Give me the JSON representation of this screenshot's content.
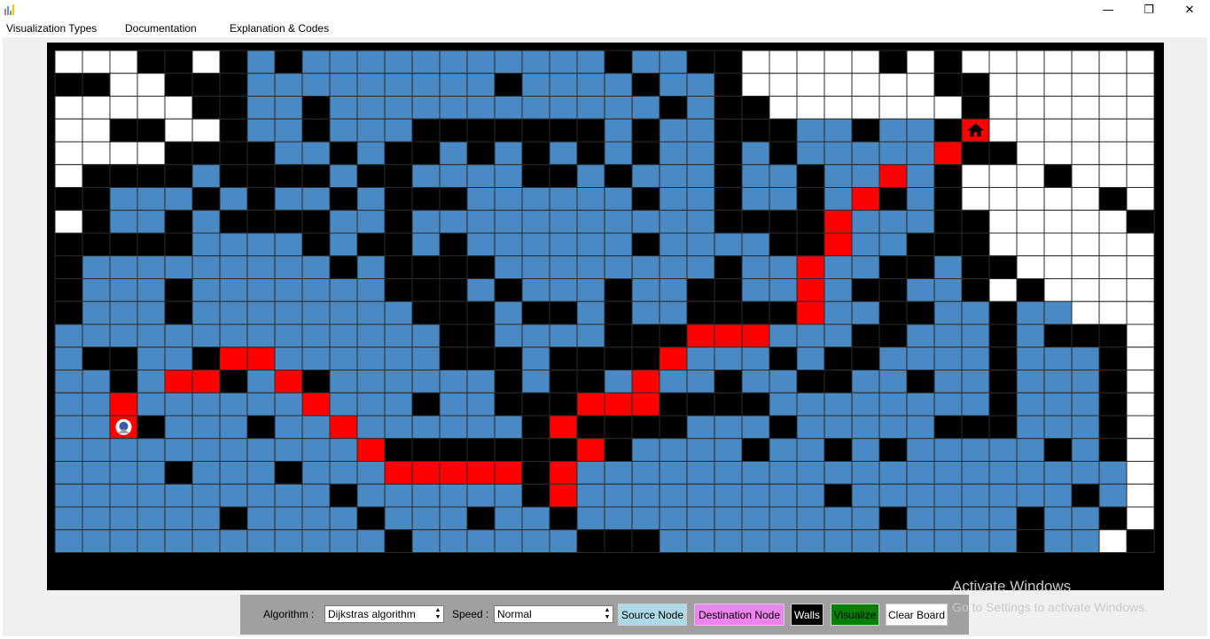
{
  "window": {
    "icon": "bar-chart-app-icon",
    "controls": {
      "minimize": "—",
      "maximize": "❐",
      "close": "✕"
    }
  },
  "menu": {
    "items": [
      "Visualization Types",
      "Documentation",
      "Explanation & Codes"
    ]
  },
  "grid": {
    "rows": 22,
    "cols": 40,
    "legend": {
      "W": "white",
      "B": "black",
      "L": "blue",
      "R": "red"
    },
    "colors": {
      "white": "#ffffff",
      "black": "#000000",
      "blue": "#4a8ac4",
      "red": "#ff0000",
      "border": "#2a2a2a"
    },
    "cells": [
      "WWWBBWBLBLLLLLLLLLLLBLLBBWWWWWBWBWWWWWWW",
      "BBWWBBBLLLLLLLLLBLLLLBLLBWWWWWWWBBWWWWWW",
      "WWWWWBBLLBLLLLLLLLLLLLBLBBWWWWWWWBWWWWWW",
      "WWBBWWBLLBLLLBBBBBBBLBLLBBBLLBLLBRWWWWWW",
      "WWWWBBBBLLBLBBLBLBLBLBLLBLBLLLLLRBBWWWWW",
      "WBBBBLBBBBLBBLLLLBBLBLLLBLLBLLRLBWWWBWWW",
      "BBLLLBLBLLBLBBBLLLLLLBLLBLLBLRBLBWWWWWBW",
      "WBLLBLBBBBLLBLLLLLLLLLLLBBBBRLLLBBWWWWWB",
      "BBBBBLLLLBLBBLBLLLLLLBLLLLBBRLLBBBWWWWWW",
      "BLLLLLLLLLBLBBBBLLLLLLLLBLLRLLBBLBBWWWWW",
      "BLLLBLLLLLLLBBBLBLLLBLLBBLLRLBBLLBWBWWWW",
      "BLLLBLLLLLLLLBBBLBBLBLLBBBBRLLBBLLBLLWWW",
      "LLLLLLLLLLLLLLBBLLLLBBBRRRLLLBBLLLBLBBBW",
      "LBBLLBRRLLLLLLBBBLBBBBRLLLBLBBLLLLBLLLBW",
      "LLBLRRBLRBLLLLLLBLBBLRLLBLLBBLLBLLBLLLBW",
      "LLRLLLLLLRLLLBLLBBBRRRBBBBLLLLLLLLBLLLBW",
      "LLSBLLLBLLRLLLLLLBRBBBBLLLBLLLLLBBBLLLBW",
      "LLLLLLLLLLLRBBBBBBBRBLLLLBLLBLBLLLLLBLBW",
      "LLLLBLLLBLLLRRRRRBRLLLLLLLLLLLLLLLLLLLLW",
      "LLLLLLLLLLBLLLLLLBRLLLLLLLLLBLLLLLLLLBLW",
      "LLLLLLBLLLLBLLLBLLBLLLLLLLLLLLBLLLLBLLBW",
      "LLLLLLLLLLLLBLLLLLLBBBLLLLLLLLLLLLLBLLWB"
    ],
    "source_icon": "source-node-icon",
    "destination_icon": "home-icon"
  },
  "toolbar": {
    "algorithm_label": "Algorithm :",
    "algorithm_value": "Dijkstras algorithm",
    "speed_label": "Speed :",
    "speed_value": "Normal",
    "source_node": "Source Node",
    "destination_node": "Destination Node",
    "walls": "Walls",
    "visualize": "Visualize",
    "clear_board": "Clear Board",
    "colors": {
      "panel": "#a0a0a0",
      "source": "#add8e6",
      "destination": "#ee82ee",
      "walls": "#000000",
      "visualize": "#008000",
      "clear": "#ffffff"
    }
  },
  "watermark": {
    "line1": "Activate Windows",
    "line2": "Go to Settings to activate Windows."
  }
}
